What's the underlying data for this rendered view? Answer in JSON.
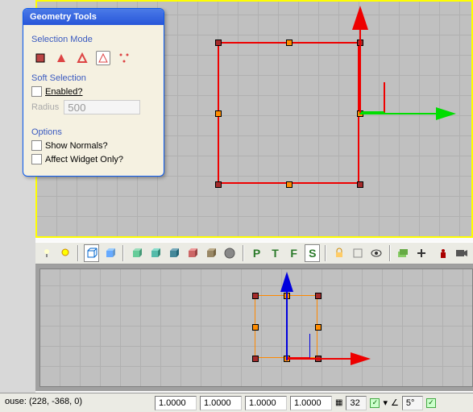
{
  "panel": {
    "title": "Geometry Tools",
    "selection_mode_label": "Selection Mode",
    "soft_selection_label": "Soft Selection",
    "enabled_label": "Enabled?",
    "radius_label": "Radius",
    "radius_value": "500",
    "options_label": "Options",
    "show_normals_label": "Show Normals?",
    "affect_widget_label": "Affect Widget Only?"
  },
  "toolbar": {
    "letters": [
      "P",
      "T",
      "F",
      "S"
    ]
  },
  "statusbar": {
    "mouse": "ouse: (228, -368, 0)",
    "v1": "1.0000",
    "v2": "1.0000",
    "v3": "1.0000",
    "v4": "1.0000",
    "grid_val": "32",
    "ang_val": "5°"
  }
}
